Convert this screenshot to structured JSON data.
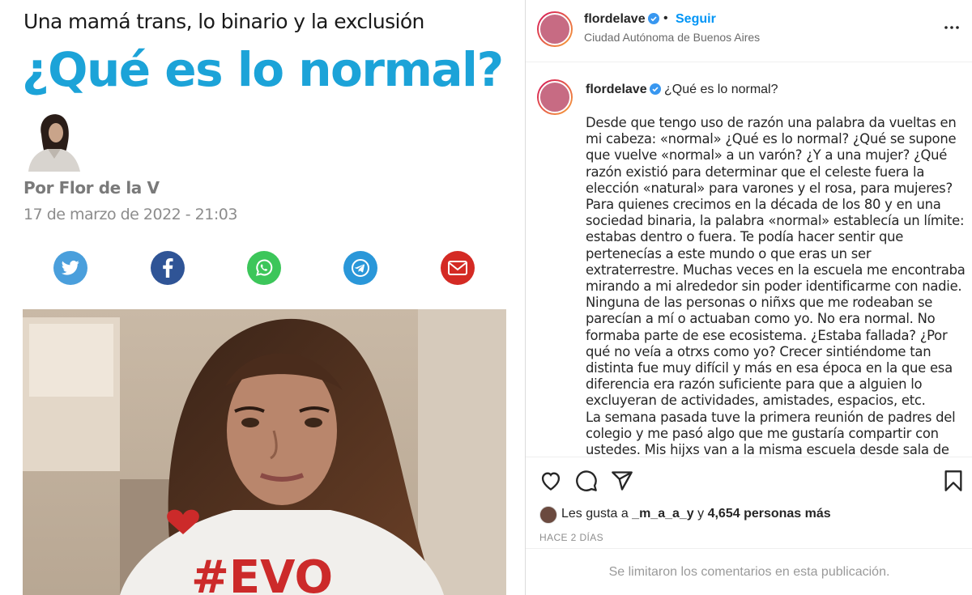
{
  "article": {
    "kicker": "Una mamá trans, lo binario y la exclusión",
    "headline": "¿Qué es lo normal?",
    "byline": "Por Flor de la V",
    "date": "17 de marzo de 2022 - 21:03",
    "share_icons": [
      "twitter-icon",
      "facebook-icon",
      "whatsapp-icon",
      "telegram-icon",
      "mail-icon"
    ],
    "colors": {
      "headline": "#1ca3d8",
      "twitter": "#4a9fdc",
      "facebook": "#2f5496",
      "whatsapp": "#3cc65a",
      "telegram": "#2a97d9",
      "mail": "#d42a24"
    }
  },
  "post": {
    "username": "flordelave",
    "follow_label": "Seguir",
    "location": "Ciudad Autónoma de Buenos Aires",
    "caption_title": "¿Qué es lo normal?",
    "caption_paragraphs": [
      "Desde que tengo uso de razón una palabra da vueltas en mi cabeza: «normal» ¿Qué es lo normal? ¿Qué se supone que vuelve «normal» a un varón? ¿Y a una mujer? ¿Qué razón existió para determinar que el celeste fuera la elección «natural» para varones y el rosa, para mujeres?",
      "Para quienes crecimos en la década de los 80 y en una sociedad binaria, la palabra «normal» establecía un límite: estabas dentro o fuera. Te podía hacer sentir que pertenecías a este mundo o que eras un ser extraterrestre. Muchas veces en la escuela me encontraba mirando a mi alrededor sin poder identificarme con nadie. Ninguna de las personas o niñxs que me rodeaban se parecían a mí o actuaban como yo. No era normal. No formaba parte de ese ecosistema. ¿Estaba fallada? ¿Por qué no veía a otrxs como yo? Crecer sintiéndome tan distinta fue muy difícil y más en esa época en la que esa diferencia era razón suficiente para que a alguien lo excluyeran de actividades, amistades, espacios, etc.",
      "La semana pasada tuve la primera reunión de padres del colegio y me pasó algo que me gustaría compartir con ustedes. Mis hijxs van a la misma escuela desde sala de tres. No sé qué cambió en mí en estos años, pero por primera vez me puse a mirar a mi"
    ],
    "likes_prefix": "Les gusta a ",
    "likes_user": "_m_a_a_y",
    "likes_mid": " y ",
    "likes_count": "4,654 personas más",
    "time_ago": "HACE 2 DÍAS",
    "comments_limited": "Se limitaron los comentarios en esta publicación.",
    "icons": [
      "heart-icon",
      "comment-icon",
      "share-icon",
      "bookmark-icon",
      "more-icon",
      "verified-icon"
    ],
    "colors": {
      "follow": "#0095f6",
      "verified": "#3897f0"
    }
  }
}
